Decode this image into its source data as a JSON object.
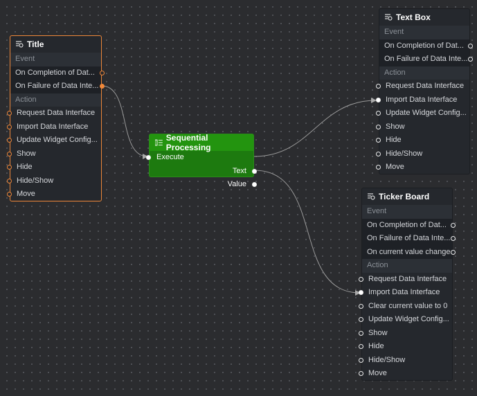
{
  "nodes": {
    "title": {
      "name": "Title",
      "event_label": "Event",
      "action_label": "Action",
      "events": [
        "On Completion of Dat...",
        "On Failure of Data Inte..."
      ],
      "actions": [
        "Request Data Interface",
        "Import Data Interface",
        "Update Widget Config...",
        "Show",
        "Hide",
        "Hide/Show",
        "Move"
      ]
    },
    "textbox": {
      "name": "Text Box",
      "event_label": "Event",
      "action_label": "Action",
      "events": [
        "On Completion of Dat...",
        "On Failure of Data Inte..."
      ],
      "actions": [
        "Request Data Interface",
        "Import Data Interface",
        "Update Widget Config...",
        "Show",
        "Hide",
        "Hide/Show",
        "Move"
      ]
    },
    "ticker": {
      "name": "Ticker Board",
      "event_label": "Event",
      "action_label": "Action",
      "events": [
        "On Completion of Dat...",
        "On Failure of Data Inte...",
        "On current value change"
      ],
      "actions": [
        "Request Data Interface",
        "Import Data Interface",
        "Clear current value to 0",
        "Update Widget Config...",
        "Show",
        "Hide",
        "Hide/Show",
        "Move"
      ]
    },
    "seq": {
      "name": "Sequential Processing",
      "input": "Execute",
      "outputs": [
        "Text",
        "Value"
      ]
    }
  },
  "colors": {
    "selected": "#f0883a",
    "logic_node": "#1d7a0f",
    "background": "#2b2c2f"
  }
}
